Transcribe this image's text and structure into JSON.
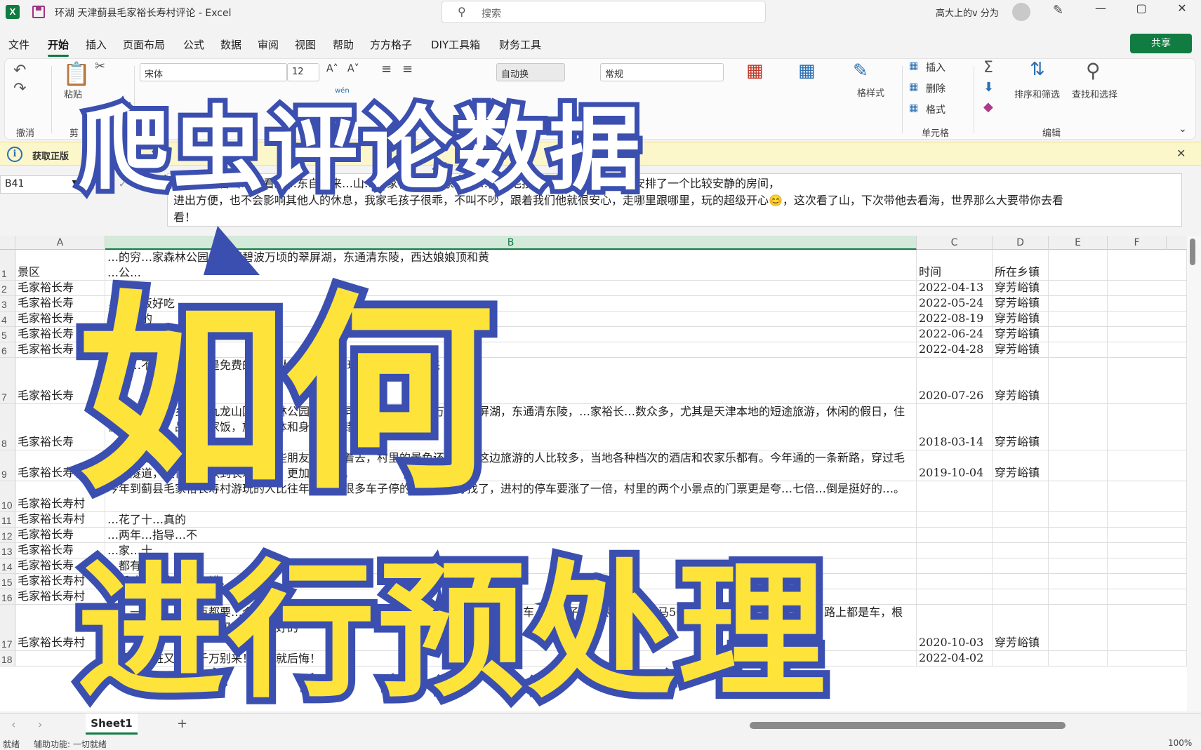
{
  "window": {
    "logo": "X",
    "title": "环湖 天津蓟县毛家裕长寿村评论 - Excel",
    "search_placeholder": "搜索",
    "search_icon": "search-icon",
    "user": "高大上的v 分为",
    "minimize": "—",
    "restore": "▢",
    "close": "✕"
  },
  "menu": {
    "items": [
      "文件",
      "开始",
      "插入",
      "页面布局",
      "公式",
      "数据",
      "审阅",
      "视图",
      "帮助",
      "方方格子",
      "DIY工具箱",
      "财务工具"
    ],
    "active": "开始",
    "share": "共享"
  },
  "ribbon": {
    "undo_group": "撤消",
    "paste": "粘贴",
    "clipboard_group": "剪",
    "font_name": "宋体",
    "font_size": "12",
    "wrap": "自动换",
    "number_format": "常规",
    "table_style": "格样式",
    "insert": "插入",
    "delete": "删除",
    "format": "格式",
    "cells_group": "单元格",
    "sort_filter": "排序和筛选",
    "find_select": "查找和选择",
    "edit_group": "编辑",
    "wen": "wén"
  },
  "infobar": {
    "text": "获取正版",
    "close": "✕"
  },
  "formula_bar": {
    "name_box": "B41",
    "fx": "✕ ✓",
    "content_line1": "计划…看看山…看看海…东自驾来…山…毛家裕长…店家…挺…我家毛孩子体积比较大，特意安排了一个比较安静的房间，",
    "content_line2": "进出方便，也不会影响其他人的休息，我家毛孩子很乖，不叫不吵，跟着我们他就很安心，走哪里跟哪里，玩的超级开心😊，这次看了山，下次带他去看海，世界那么大要带你去看",
    "content_line3": "看！"
  },
  "grid": {
    "columns": [
      "A",
      "B",
      "C",
      "D",
      "E",
      "F"
    ],
    "selected_column": "B",
    "rows": [
      {
        "n": "1",
        "a": "景区",
        "b": "…的穷…家森林公园，南邻碧波万顷的翠屏湖，东通清东陵，西达娘娘顶和黄",
        "b2": "…公…",
        "c": "时间",
        "d": "所在乡镇",
        "h": 44,
        "top": true
      },
      {
        "n": "2",
        "a": "毛家裕长寿",
        "b": "",
        "c": "2022-04-13",
        "d": "穿芳峪镇",
        "h": 22
      },
      {
        "n": "3",
        "a": "毛家裕长寿",
        "b": "，农家饭好吃",
        "c": "2022-05-24",
        "d": "穿芳峪镇",
        "h": 22
      },
      {
        "n": "4",
        "a": "毛家裕长寿",
        "b": "是不错的",
        "c": "2022-08-19",
        "d": "穿芳峪镇",
        "h": 22
      },
      {
        "n": "5",
        "a": "毛家裕长寿",
        "b": "",
        "c": "2022-06-24",
        "d": "穿芳峪镇",
        "h": 22
      },
      {
        "n": "6",
        "a": "毛家裕长寿",
        "b": "",
        "c": "2022-04-28",
        "d": "穿芳峪镇",
        "h": 22
      },
      {
        "n": "7",
        "a": "毛家裕长寿",
        "b": "门票…不可以爬山也是免费的    带老人孩子都可以玩的    下次还会在来",
        "c": "2020-07-26",
        "d": "穿芳峪镇",
        "h": 66
      },
      {
        "n": "8",
        "a": "毛家裕长寿",
        "b": "…蓟州…芳裕乡…园九龙山国家森林公园相邻，同时南部也有碧波万顷的翠屏湖，东通清东陵，…家裕长…数众多，尤其是天津本地的短途旅游，休闲的假日，住在长寿村里，品尝农家饭，放松身体和身心，不错的选择。",
        "c": "2018-03-14",
        "d": "穿芳峪镇",
        "h": 66
      },
      {
        "n": "9",
        "a": "毛家裕长寿村",
        "b": "蓟县的毛家峪长寿村，每年我们这些朋友都会约着去，村里的景色还可以。这边旅游的人比较多，当地各种档次的酒店和农家乐都有。今年通的一条新路，穿过毛家峪隧道，很快就可以到长寿村了，更加的方便。",
        "c": "2019-10-04",
        "d": "穿芳峪镇",
        "h": 44
      },
      {
        "n": "10",
        "a": "毛家裕长寿村",
        "b": "今年到蓟县毛家裕长寿村游玩的人比往年多了，很多车子停的地方都不好找了，进村的停车要涨了一倍，村里的两个小景点的门票更是夸…七倍…倒是挺好的…。",
        "c": "",
        "d": "",
        "h": 44
      },
      {
        "n": "11",
        "a": "毛家裕长寿村",
        "b": "…花了十…真的",
        "c": "",
        "d": "",
        "h": 22
      },
      {
        "n": "12",
        "a": "毛家裕长寿",
        "b": "…两年…指导…不",
        "c": "",
        "d": "",
        "h": 22
      },
      {
        "n": "13",
        "a": "毛家裕长寿",
        "b": "…家…十",
        "c": "",
        "d": "",
        "h": 22
      },
      {
        "n": "14",
        "a": "毛家裕长寿",
        "b": "…都有",
        "c": "",
        "d": "",
        "h": 22
      },
      {
        "n": "15",
        "a": "毛家裕长寿村",
        "b": "…后才…长寿村…不错。",
        "c": "",
        "d": "",
        "h": 22
      },
      {
        "n": "16",
        "a": "毛家裕长寿村",
        "b": "…惠。饭…唯一卫…些",
        "c": "",
        "d": "",
        "h": 22
      },
      {
        "n": "17",
        "a": "毛家裕长寿村",
        "b": "来…一个村，有…点都要…个情人谷，…林…农…乞…款用品，没有…点，村里都是车，带孩子的不太安全，骑马50，打枪30，骑…30一小时，路上都是车，根本骑不动，就山货市场买的栗子挺好的",
        "c": "2020-10-03",
        "d": "穿芳峪镇",
        "h": 66
      },
      {
        "n": "18",
        "a": "",
        "b": "没啥，又脏又乱，千万别来！来了就后悔！",
        "c": "2022-04-02",
        "d": "",
        "h": 22
      }
    ]
  },
  "sheets": {
    "active": "Sheet1",
    "add": "+"
  },
  "status": {
    "ready": "就绪",
    "accessibility": "辅助功能: 一切就绪",
    "zoom": "100%"
  },
  "overlay": {
    "line1": "爬虫评论数据",
    "line2": "如何",
    "line3": "进行预处理"
  }
}
